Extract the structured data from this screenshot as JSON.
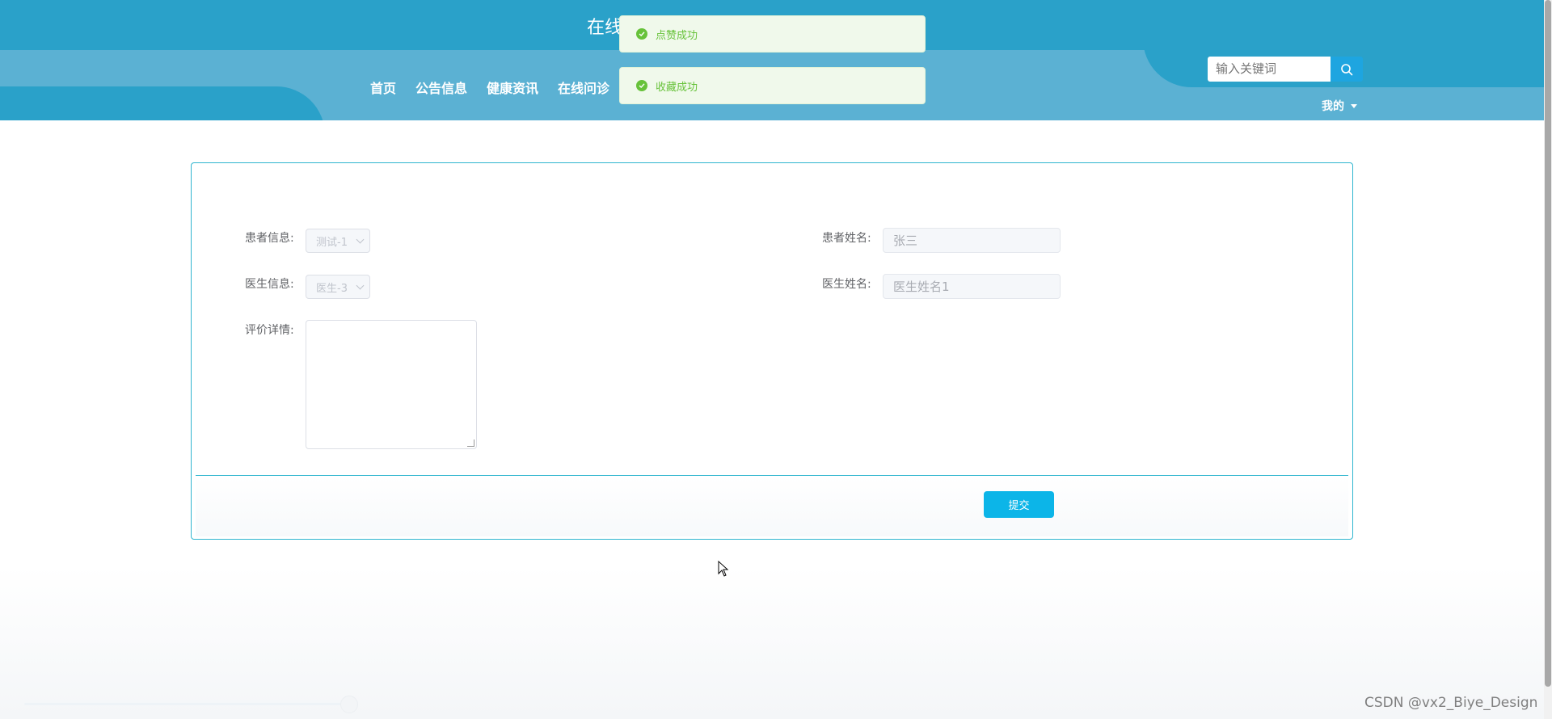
{
  "header": {
    "site_title": "在线",
    "nav": [
      "首页",
      "公告信息",
      "健康资讯",
      "在线问诊"
    ],
    "search_placeholder": "输入关键词",
    "user_menu_label": "我的"
  },
  "toasts": [
    "点赞成功",
    "收藏成功"
  ],
  "form": {
    "patient_info_label": "患者信息:",
    "patient_info_value": "测试-1",
    "patient_name_label": "患者姓名:",
    "patient_name_value": "张三",
    "doctor_info_label": "医生信息:",
    "doctor_info_value": "医生-3",
    "doctor_name_label": "医生姓名:",
    "doctor_name_value": "医生姓名1",
    "review_label": "评价详情:",
    "submit_label": "提交"
  },
  "watermark": "CSDN @vx2_Biye_Design",
  "colors": {
    "header_dark": "#2aa1c9",
    "header_light": "#5bb1d3",
    "primary_button": "#0cb5e8",
    "success": "#67c23a",
    "card_border": "#2fb5cf"
  }
}
